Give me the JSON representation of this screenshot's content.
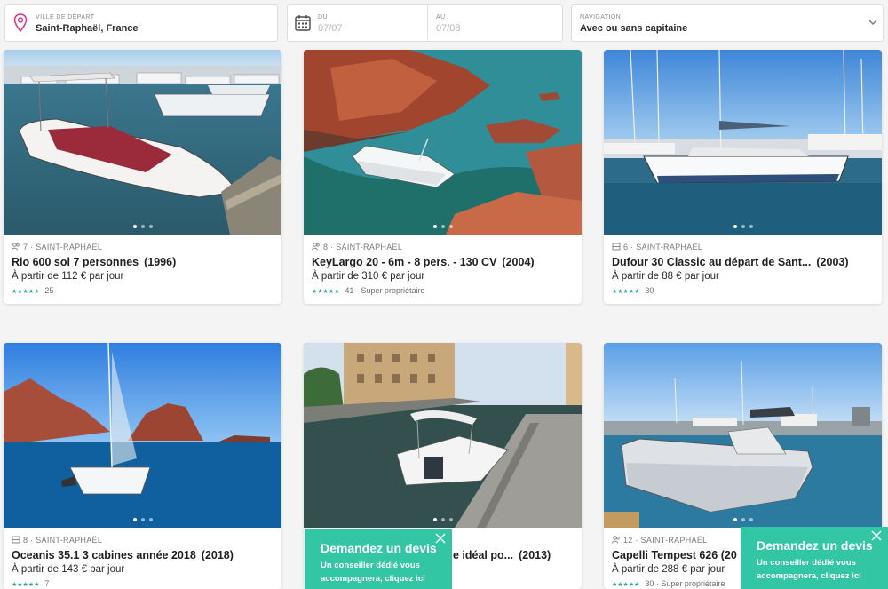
{
  "search": {
    "city_label": "VILLE DE DÉPART",
    "city_value": "Saint-Raphaël, France",
    "from_label": "DU",
    "from_value": "07/07",
    "to_label": "AU",
    "to_value": "07/08",
    "nav_label": "NAVIGATION",
    "nav_value": "Avec ou sans capitaine"
  },
  "colors": {
    "accent": "#33c6a4",
    "stars": "#2aa58e",
    "pin": "#d43a8a"
  },
  "icons": [
    "map-pin-icon",
    "calendar-icon",
    "chevron-down-icon",
    "people-icon",
    "cabin-icon",
    "star-icon",
    "close-icon"
  ],
  "listings": [
    {
      "capacity": "7",
      "city": "SAINT-RAPHAËL",
      "meta_icon": "people-icon",
      "title": "Rio 600 sol 7 personnes",
      "year": "(1996)",
      "price": "À partir de 112 € par jour",
      "reviews": "25",
      "badge": ""
    },
    {
      "capacity": "8",
      "city": "SAINT-RAPHAËL",
      "meta_icon": "people-icon",
      "title": "KeyLargo 20 - 6m - 8 pers. - 130 CV",
      "year": "(2004)",
      "price": "À partir de 310 € par jour",
      "reviews": "41",
      "badge": "· Super propriétaire"
    },
    {
      "capacity": "6",
      "city": "SAINT-RAPHAËL",
      "meta_icon": "cabin-icon",
      "title": "Dufour 30 Classic au départ de Sant...",
      "year": "(2003)",
      "price": "À partir de 88 € par jour",
      "reviews": "30",
      "badge": ""
    },
    {
      "capacity": "8",
      "city": "SAINT-RAPHAËL",
      "meta_icon": "cabin-icon",
      "title": "Oceanis 35.1 3 cabines année 2018",
      "year": "(2018)",
      "price": "À partir de 143 € par jour",
      "reviews": "7",
      "badge": ""
    },
    {
      "title_tail": "e idéal po...",
      "year": "(2013)"
    },
    {
      "capacity": "12",
      "city": "SAINT-RAPHAËL",
      "meta_icon": "people-icon",
      "title": "Capelli Tempest 626 (20",
      "year": "",
      "price": "À partir de 288 € par jour",
      "reviews": "30",
      "badge": "· Super propriétaire"
    }
  ],
  "devis": {
    "title": "Demandez un devis",
    "line1": "Un conseiller dédié vous",
    "line2": "accompagnera, cliquez ici"
  }
}
